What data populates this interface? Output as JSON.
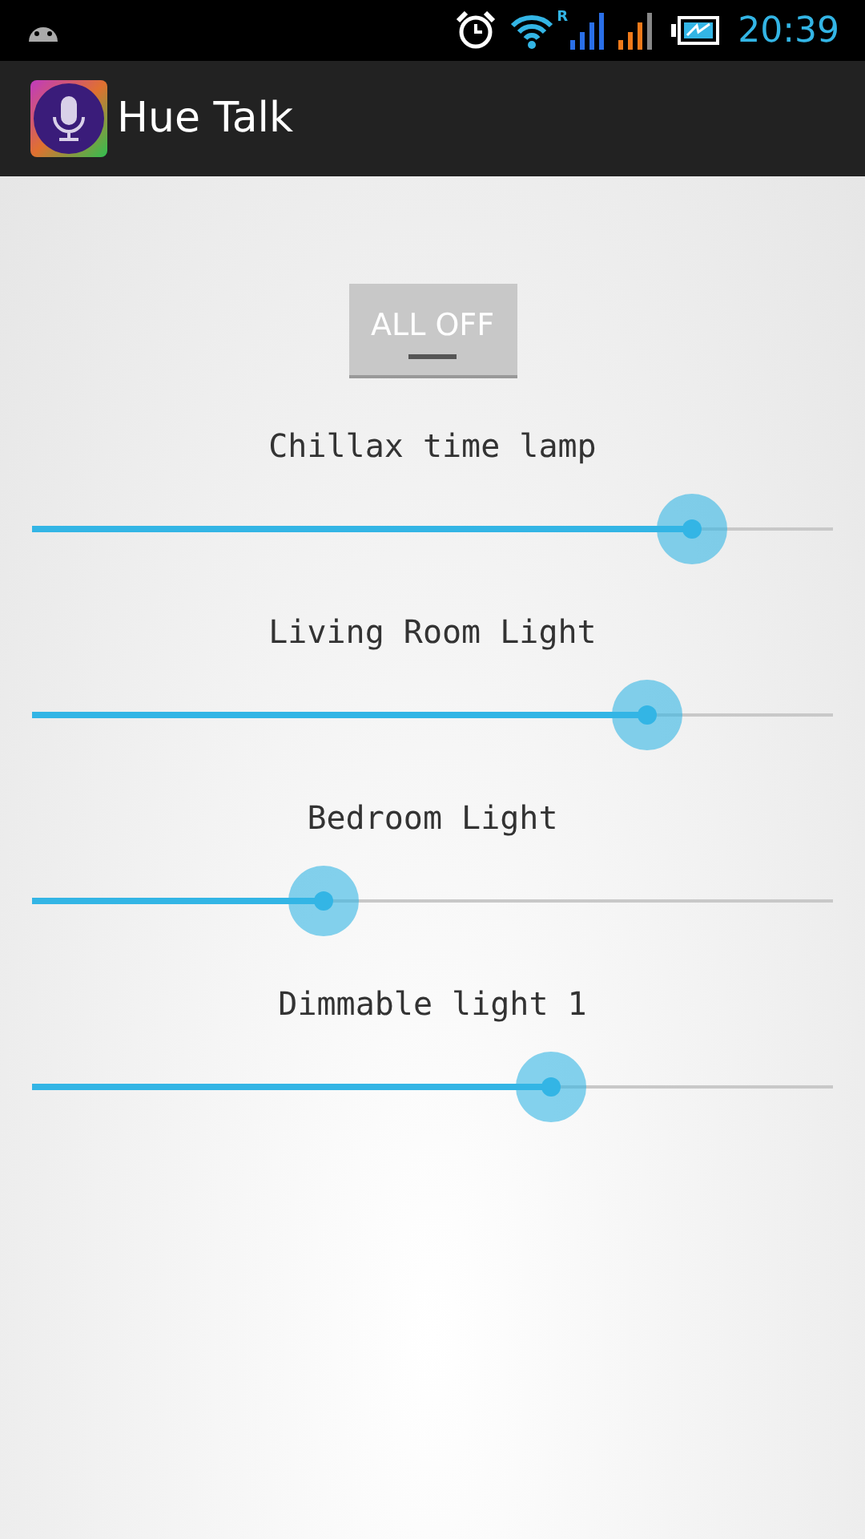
{
  "status_bar": {
    "roaming": "R",
    "time": "20:39"
  },
  "app_bar": {
    "title": "Hue Talk"
  },
  "all_off_button": {
    "label": "ALL OFF",
    "on": false
  },
  "lights": [
    {
      "name": "Chillax time lamp",
      "level": 0.824
    },
    {
      "name": "Living Room Light",
      "level": 0.768
    },
    {
      "name": "Bedroom Light",
      "level": 0.364
    },
    {
      "name": "Dimmable light 1",
      "level": 0.648
    }
  ]
}
